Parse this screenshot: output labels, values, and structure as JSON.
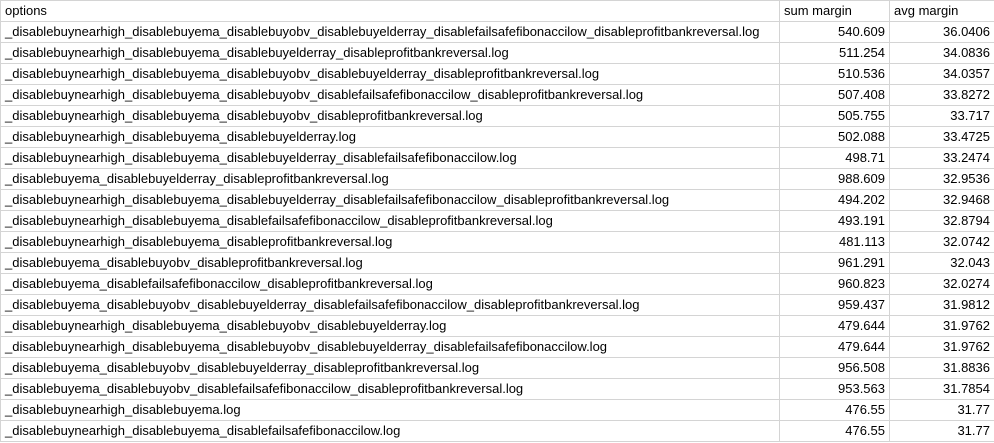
{
  "table": {
    "headers": [
      "options",
      "sum margin",
      "avg margin"
    ],
    "rows": [
      [
        "_disablebuynearhigh_disablebuyema_disablebuyobv_disablebuyelderray_disablefailsafefibonaccilow_disableprofitbankreversal.log",
        "540.609",
        "36.0406"
      ],
      [
        "_disablebuynearhigh_disablebuyema_disablebuyelderray_disableprofitbankreversal.log",
        "511.254",
        "34.0836"
      ],
      [
        "_disablebuynearhigh_disablebuyema_disablebuyobv_disablebuyelderray_disableprofitbankreversal.log",
        "510.536",
        "34.0357"
      ],
      [
        "_disablebuynearhigh_disablebuyema_disablebuyobv_disablefailsafefibonaccilow_disableprofitbankreversal.log",
        "507.408",
        "33.8272"
      ],
      [
        "_disablebuynearhigh_disablebuyema_disablebuyobv_disableprofitbankreversal.log",
        "505.755",
        "33.717"
      ],
      [
        "_disablebuynearhigh_disablebuyema_disablebuyelderray.log",
        "502.088",
        "33.4725"
      ],
      [
        "_disablebuynearhigh_disablebuyema_disablebuyelderray_disablefailsafefibonaccilow.log",
        "498.71",
        "33.2474"
      ],
      [
        "_disablebuyema_disablebuyelderray_disableprofitbankreversal.log",
        "988.609",
        "32.9536"
      ],
      [
        "_disablebuynearhigh_disablebuyema_disablebuyelderray_disablefailsafefibonaccilow_disableprofitbankreversal.log",
        "494.202",
        "32.9468"
      ],
      [
        "_disablebuynearhigh_disablebuyema_disablefailsafefibonaccilow_disableprofitbankreversal.log",
        "493.191",
        "32.8794"
      ],
      [
        "_disablebuynearhigh_disablebuyema_disableprofitbankreversal.log",
        "481.113",
        "32.0742"
      ],
      [
        "_disablebuyema_disablebuyobv_disableprofitbankreversal.log",
        "961.291",
        "32.043"
      ],
      [
        "_disablebuyema_disablefailsafefibonaccilow_disableprofitbankreversal.log",
        "960.823",
        "32.0274"
      ],
      [
        "_disablebuyema_disablebuyobv_disablebuyelderray_disablefailsafefibonaccilow_disableprofitbankreversal.log",
        "959.437",
        "31.9812"
      ],
      [
        "_disablebuynearhigh_disablebuyema_disablebuyobv_disablebuyelderray.log",
        "479.644",
        "31.9762"
      ],
      [
        "_disablebuynearhigh_disablebuyema_disablebuyobv_disablebuyelderray_disablefailsafefibonaccilow.log",
        "479.644",
        "31.9762"
      ],
      [
        "_disablebuyema_disablebuyobv_disablebuyelderray_disableprofitbankreversal.log",
        "956.508",
        "31.8836"
      ],
      [
        "_disablebuyema_disablebuyobv_disablefailsafefibonaccilow_disableprofitbankreversal.log",
        "953.563",
        "31.7854"
      ],
      [
        "_disablebuynearhigh_disablebuyema.log",
        "476.55",
        "31.77"
      ],
      [
        "_disablebuynearhigh_disablebuyema_disablefailsafefibonaccilow.log",
        "476.55",
        "31.77"
      ]
    ]
  }
}
